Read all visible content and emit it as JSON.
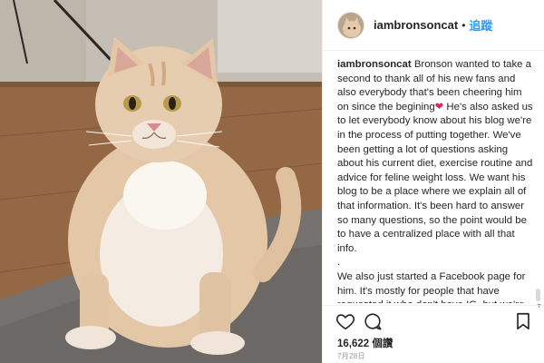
{
  "post": {
    "username": "iambronsoncat",
    "separator": "•",
    "follow_label": "追蹤",
    "caption": {
      "author": "iambronsoncat",
      "text_part1": "Bronson wanted to take a second to thank all of his new fans and also everybody that's been cheering him on since the begining",
      "heart": "❤",
      "text_part2": " He's also asked us to let everybody know about his blog we're in the process of putting together. We've been getting a lot of questions asking about his current diet, exercise routine and advice for feline weight loss. We want his blog to be a place where we explain all of that information. It's been hard to answer so many questions, so the point would be to have a centralized place with all that info.",
      "separator_dot": ".",
      "paragraph2": "We also just started a Facebook page for him. It's mostly for people that have requested it who don't have IG, but we're also going to be posting a little different content on there, in case people are"
    },
    "likes": "16,622 個讚",
    "date": "7月28日"
  },
  "icons": {
    "like": "heart-outline-icon",
    "comment": "speech-bubble-icon",
    "save": "bookmark-icon"
  },
  "colors": {
    "link": "#3897f0",
    "text": "#262626",
    "muted": "#999999",
    "heart": "#e0245e"
  }
}
